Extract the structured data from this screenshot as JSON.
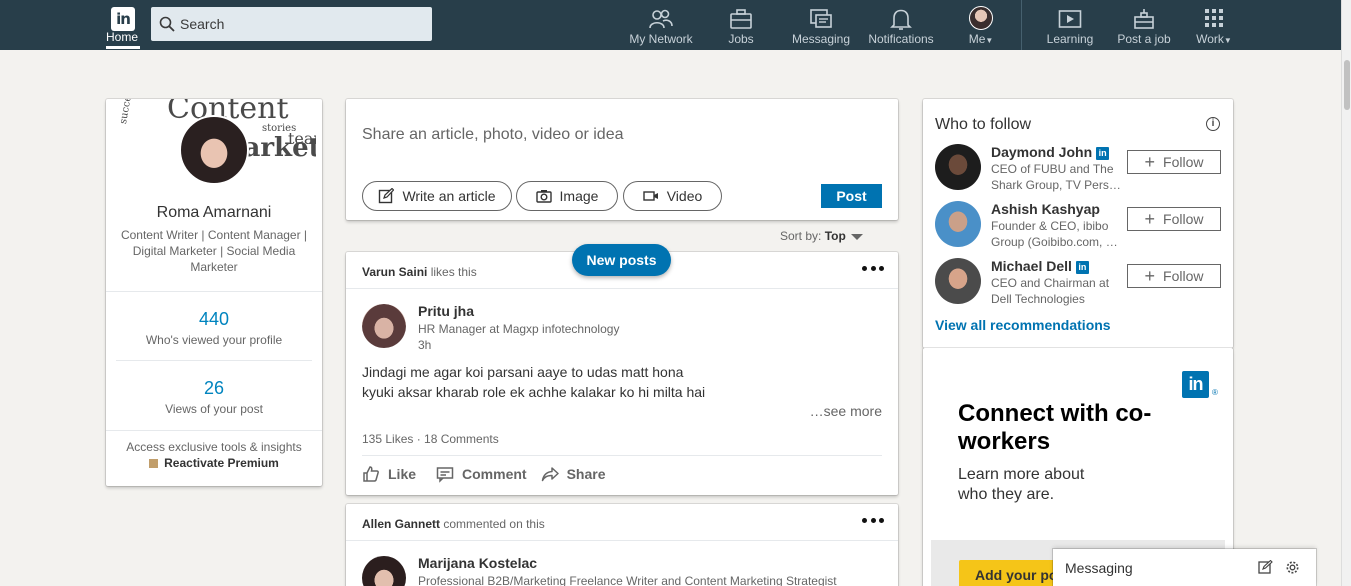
{
  "nav": {
    "logo": "in",
    "home_label": "Home",
    "search_placeholder": "Search",
    "items": [
      {
        "label": "My Network"
      },
      {
        "label": "Jobs"
      },
      {
        "label": "Messaging"
      },
      {
        "label": "Notifications"
      },
      {
        "label": "Me"
      },
      {
        "label": "Learning"
      },
      {
        "label": "Post a job"
      },
      {
        "label": "Work"
      }
    ]
  },
  "profile": {
    "name": "Roma Amarnani",
    "headline": "Content Writer | Content Manager | Digital Marketer | Social Media Marketer",
    "banner_words": [
      "Content",
      "successful",
      "team",
      "marketing",
      "stories"
    ],
    "views_count": "440",
    "views_label": "Who's viewed your profile",
    "post_views_count": "26",
    "post_views_label": "Views of your post",
    "premium_text": "Access exclusive tools & insights",
    "premium_link": "Reactivate Premium"
  },
  "share": {
    "placeholder": "Share an article, photo, video or idea",
    "write_article": "Write an article",
    "image": "Image",
    "video": "Video",
    "post": "Post"
  },
  "sort": {
    "label": "Sort by:",
    "value": "Top"
  },
  "new_posts": "New posts",
  "feed": [
    {
      "context_actor": "Varun Saini",
      "context_action": "likes this",
      "actor_name": "Pritu jha",
      "actor_headline": "HR Manager at Magxp infotechnology",
      "time": "3h",
      "text_line1": "Jindagi me agar koi parsani aaye to udas matt hona",
      "text_line2": "kyuki aksar kharab role ek achhe kalakar ko hi milta hai",
      "see_more": "…see more",
      "counts": "135 Likes · 18 Comments",
      "like": "Like",
      "comment": "Comment",
      "share": "Share"
    },
    {
      "context_actor": "Allen Gannett",
      "context_action": "commented on this",
      "actor_name": "Marijana Kostelac",
      "actor_headline": "Professional B2B/Marketing Freelance Writer and Content Marketing Strategist"
    }
  ],
  "who_to_follow": {
    "title": "Who to follow",
    "recs": [
      {
        "name": "Daymond John",
        "desc": "CEO of FUBU and The Shark Group, TV Pers…"
      },
      {
        "name": "Ashish Kashyap",
        "desc": "Founder & CEO, ibibo Group (Goibibo.com, …"
      },
      {
        "name": "Michael Dell",
        "desc": "CEO and Chairman at Dell Technologies"
      }
    ],
    "follow_label": "Follow",
    "view_all": "View all recommendations"
  },
  "ad": {
    "logo": "in",
    "registered": "®",
    "headline": "Connect with co-workers",
    "sub": "Learn more about who they are.",
    "cta": "Add your po"
  },
  "messaging_bar": {
    "label": "Messaging"
  },
  "colors": {
    "nav_bg": "#283e4a",
    "accent": "#0073b1",
    "link": "#0084bf",
    "page_bg": "#f3f2ef"
  }
}
